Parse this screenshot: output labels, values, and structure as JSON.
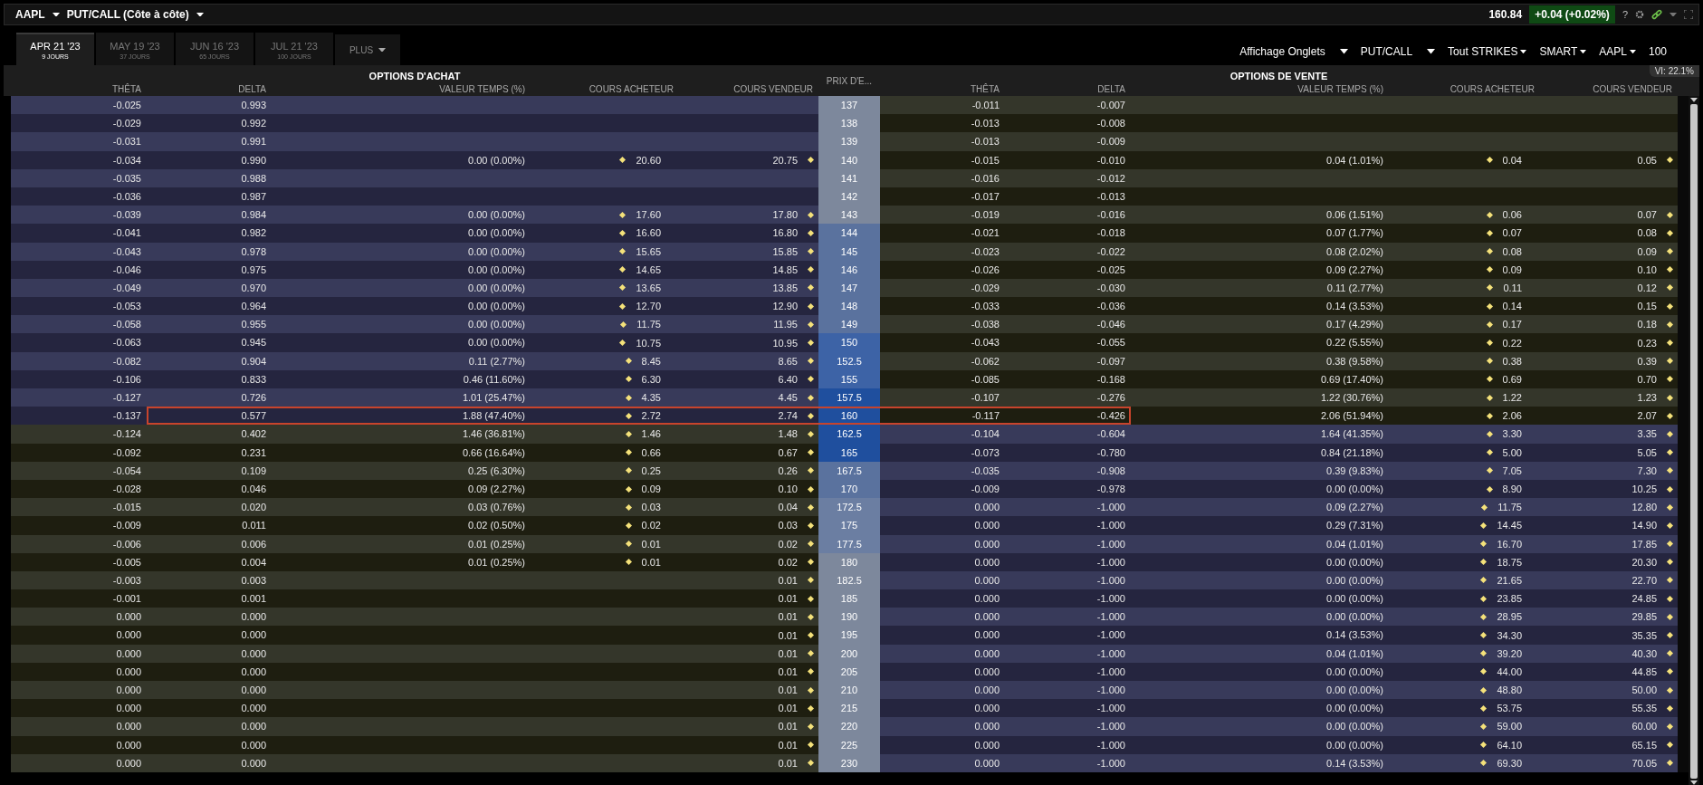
{
  "top_bar": {
    "symbol": "AAPL",
    "view": "PUT/CALL (Côte à côte)",
    "last_price": "160.84",
    "change": "+0.04 (+0.02%)",
    "help": "?"
  },
  "expiry_tabs": [
    {
      "label": "APR 21 '23",
      "days": "9 JOURS",
      "selected": true
    },
    {
      "label": "MAY 19 '23",
      "days": "37 JOURS",
      "selected": false
    },
    {
      "label": "JUN 16 '23",
      "days": "65 JOURS",
      "selected": false
    },
    {
      "label": "JUL 21 '23",
      "days": "100 JOURS",
      "selected": false
    }
  ],
  "more_tab": "PLUS",
  "toolbar": [
    {
      "label": "Affichage Onglets",
      "kind": "wide"
    },
    {
      "label": "PUT/CALL",
      "kind": "wide"
    },
    {
      "label": "Tout STRIKES",
      "kind": "compact"
    },
    {
      "label": "SMART",
      "kind": "compact"
    },
    {
      "label": "AAPL",
      "kind": "compact"
    },
    {
      "label": "100",
      "kind": "plain"
    }
  ],
  "implied_volatility": "VI: 22.1%",
  "calls_title": "OPTIONS D'ACHAT",
  "puts_title": "OPTIONS DE VENTE",
  "strike_header": "PRIX D'E...",
  "call_columns": [
    "THÊTA",
    "DELTA",
    "VALEUR TEMPS (%)",
    "COURS ACHETEUR",
    "COURS VENDEUR"
  ],
  "put_columns": [
    "THÊTA",
    "DELTA",
    "VALEUR TEMPS (%)",
    "COURS ACHETEUR",
    "COURS VENDEUR"
  ],
  "rows": [
    {
      "strike": "137",
      "color": "#7d889c",
      "calls_in_money": true,
      "puts_in_money": false,
      "selected": false,
      "call": {
        "theta": "-0.025",
        "delta": "0.993"
      },
      "put": {
        "theta": "-0.011",
        "delta": "-0.007"
      }
    },
    {
      "strike": "138",
      "color": "#7d889c",
      "calls_in_money": true,
      "puts_in_money": false,
      "selected": false,
      "call": {
        "theta": "-0.029",
        "delta": "0.992"
      },
      "put": {
        "theta": "-0.013",
        "delta": "-0.008"
      }
    },
    {
      "strike": "139",
      "color": "#7d889c",
      "calls_in_money": true,
      "puts_in_money": false,
      "selected": false,
      "call": {
        "theta": "-0.031",
        "delta": "0.991"
      },
      "put": {
        "theta": "-0.013",
        "delta": "-0.009"
      }
    },
    {
      "strike": "140",
      "color": "#7d889c",
      "calls_in_money": true,
      "puts_in_money": false,
      "selected": false,
      "call": {
        "theta": "-0.034",
        "delta": "0.990",
        "time_value": "0.00 (0.00%)",
        "bid": "20.60",
        "ask": "20.75"
      },
      "put": {
        "theta": "-0.015",
        "delta": "-0.010",
        "time_value": "0.04 (1.01%)",
        "bid": "0.04",
        "ask": "0.05"
      }
    },
    {
      "strike": "141",
      "color": "#7d889c",
      "calls_in_money": true,
      "puts_in_money": false,
      "selected": false,
      "call": {
        "theta": "-0.035",
        "delta": "0.988"
      },
      "put": {
        "theta": "-0.016",
        "delta": "-0.012"
      }
    },
    {
      "strike": "142",
      "color": "#7d889c",
      "calls_in_money": true,
      "puts_in_money": false,
      "selected": false,
      "call": {
        "theta": "-0.036",
        "delta": "0.987"
      },
      "put": {
        "theta": "-0.017",
        "delta": "-0.013"
      }
    },
    {
      "strike": "143",
      "color": "#7d889c",
      "calls_in_money": true,
      "puts_in_money": false,
      "selected": false,
      "call": {
        "theta": "-0.039",
        "delta": "0.984",
        "time_value": "0.00 (0.00%)",
        "bid": "17.60",
        "ask": "17.80"
      },
      "put": {
        "theta": "-0.019",
        "delta": "-0.016",
        "time_value": "0.06 (1.51%)",
        "bid": "0.06",
        "ask": "0.07"
      }
    },
    {
      "strike": "144",
      "color": "#5a729e",
      "calls_in_money": true,
      "puts_in_money": false,
      "selected": false,
      "call": {
        "theta": "-0.041",
        "delta": "0.982",
        "time_value": "0.00 (0.00%)",
        "bid": "16.60",
        "ask": "16.80"
      },
      "put": {
        "theta": "-0.021",
        "delta": "-0.018",
        "time_value": "0.07 (1.77%)",
        "bid": "0.07",
        "ask": "0.08"
      }
    },
    {
      "strike": "145",
      "color": "#5a729e",
      "calls_in_money": true,
      "puts_in_money": false,
      "selected": false,
      "call": {
        "theta": "-0.043",
        "delta": "0.978",
        "time_value": "0.00 (0.00%)",
        "bid": "15.65",
        "ask": "15.85"
      },
      "put": {
        "theta": "-0.023",
        "delta": "-0.022",
        "time_value": "0.08 (2.02%)",
        "bid": "0.08",
        "ask": "0.09"
      }
    },
    {
      "strike": "146",
      "color": "#5a729e",
      "calls_in_money": true,
      "puts_in_money": false,
      "selected": false,
      "call": {
        "theta": "-0.046",
        "delta": "0.975",
        "time_value": "0.00 (0.00%)",
        "bid": "14.65",
        "ask": "14.85"
      },
      "put": {
        "theta": "-0.026",
        "delta": "-0.025",
        "time_value": "0.09 (2.27%)",
        "bid": "0.09",
        "ask": "0.10"
      }
    },
    {
      "strike": "147",
      "color": "#5a729e",
      "calls_in_money": true,
      "puts_in_money": false,
      "selected": false,
      "call": {
        "theta": "-0.049",
        "delta": "0.970",
        "time_value": "0.00 (0.00%)",
        "bid": "13.65",
        "ask": "13.85"
      },
      "put": {
        "theta": "-0.029",
        "delta": "-0.030",
        "time_value": "0.11 (2.77%)",
        "bid": "0.11",
        "ask": "0.12"
      }
    },
    {
      "strike": "148",
      "color": "#5a729e",
      "calls_in_money": true,
      "puts_in_money": false,
      "selected": false,
      "call": {
        "theta": "-0.053",
        "delta": "0.964",
        "time_value": "0.00 (0.00%)",
        "bid": "12.70",
        "ask": "12.90"
      },
      "put": {
        "theta": "-0.033",
        "delta": "-0.036",
        "time_value": "0.14 (3.53%)",
        "bid": "0.14",
        "ask": "0.15"
      }
    },
    {
      "strike": "149",
      "color": "#5a729e",
      "calls_in_money": true,
      "puts_in_money": false,
      "selected": false,
      "call": {
        "theta": "-0.058",
        "delta": "0.955",
        "time_value": "0.00 (0.00%)",
        "bid": "11.75",
        "ask": "11.95"
      },
      "put": {
        "theta": "-0.038",
        "delta": "-0.046",
        "time_value": "0.17 (4.29%)",
        "bid": "0.17",
        "ask": "0.18"
      }
    },
    {
      "strike": "150",
      "color": "#3d63a6",
      "calls_in_money": true,
      "puts_in_money": false,
      "selected": false,
      "call": {
        "theta": "-0.063",
        "delta": "0.945",
        "time_value": "0.00 (0.00%)",
        "bid": "10.75",
        "ask": "10.95"
      },
      "put": {
        "theta": "-0.043",
        "delta": "-0.055",
        "time_value": "0.22 (5.55%)",
        "bid": "0.22",
        "ask": "0.23"
      }
    },
    {
      "strike": "152.5",
      "color": "#3d63a6",
      "calls_in_money": true,
      "puts_in_money": false,
      "selected": false,
      "call": {
        "theta": "-0.082",
        "delta": "0.904",
        "time_value": "0.11 (2.77%)",
        "bid": "8.45",
        "ask": "8.65"
      },
      "put": {
        "theta": "-0.062",
        "delta": "-0.097",
        "time_value": "0.38 (9.58%)",
        "bid": "0.38",
        "ask": "0.39"
      }
    },
    {
      "strike": "155",
      "color": "#3d63a6",
      "calls_in_money": true,
      "puts_in_money": false,
      "selected": false,
      "call": {
        "theta": "-0.106",
        "delta": "0.833",
        "time_value": "0.46 (11.60%)",
        "bid": "6.30",
        "ask": "6.40"
      },
      "put": {
        "theta": "-0.085",
        "delta": "-0.168",
        "time_value": "0.69 (17.40%)",
        "bid": "0.69",
        "ask": "0.70"
      }
    },
    {
      "strike": "157.5",
      "color": "#1f4f9e",
      "calls_in_money": true,
      "puts_in_money": false,
      "selected": false,
      "call": {
        "theta": "-0.127",
        "delta": "0.726",
        "time_value": "1.01 (25.47%)",
        "bid": "4.35",
        "ask": "4.45"
      },
      "put": {
        "theta": "-0.107",
        "delta": "-0.276",
        "time_value": "1.22 (30.76%)",
        "bid": "1.22",
        "ask": "1.23"
      }
    },
    {
      "strike": "160",
      "color": "#1f4f9e",
      "calls_in_money": true,
      "puts_in_money": false,
      "selected": true,
      "call": {
        "theta": "-0.137",
        "delta": "0.577",
        "time_value": "1.88 (47.40%)",
        "bid": "2.72",
        "ask": "2.74"
      },
      "put": {
        "theta": "-0.117",
        "delta": "-0.426",
        "time_value": "2.06 (51.94%)",
        "bid": "2.06",
        "ask": "2.07"
      }
    },
    {
      "strike": "162.5",
      "color": "#1f4f9e",
      "calls_in_money": false,
      "puts_in_money": true,
      "selected": false,
      "call": {
        "theta": "-0.124",
        "delta": "0.402",
        "time_value": "1.46 (36.81%)",
        "bid": "1.46",
        "ask": "1.48"
      },
      "put": {
        "theta": "-0.104",
        "delta": "-0.604",
        "time_value": "1.64 (41.35%)",
        "bid": "3.30",
        "ask": "3.35"
      }
    },
    {
      "strike": "165",
      "color": "#1f4f9e",
      "calls_in_money": false,
      "puts_in_money": true,
      "selected": false,
      "call": {
        "theta": "-0.092",
        "delta": "0.231",
        "time_value": "0.66 (16.64%)",
        "bid": "0.66",
        "ask": "0.67"
      },
      "put": {
        "theta": "-0.073",
        "delta": "-0.780",
        "time_value": "0.84 (21.18%)",
        "bid": "5.00",
        "ask": "5.05"
      }
    },
    {
      "strike": "167.5",
      "color": "#5a729e",
      "calls_in_money": false,
      "puts_in_money": true,
      "selected": false,
      "call": {
        "theta": "-0.054",
        "delta": "0.109",
        "time_value": "0.25 (6.30%)",
        "bid": "0.25",
        "ask": "0.26"
      },
      "put": {
        "theta": "-0.035",
        "delta": "-0.908",
        "time_value": "0.39 (9.83%)",
        "bid": "7.05",
        "ask": "7.30"
      }
    },
    {
      "strike": "170",
      "color": "#5a729e",
      "calls_in_money": false,
      "puts_in_money": true,
      "selected": false,
      "call": {
        "theta": "-0.028",
        "delta": "0.046",
        "time_value": "0.09 (2.27%)",
        "bid": "0.09",
        "ask": "0.10"
      },
      "put": {
        "theta": "-0.009",
        "delta": "-0.978",
        "time_value": "0.00 (0.00%)",
        "bid": "8.90",
        "ask": "10.25"
      }
    },
    {
      "strike": "172.5",
      "color": "#6b7ea2",
      "calls_in_money": false,
      "puts_in_money": true,
      "selected": false,
      "call": {
        "theta": "-0.015",
        "delta": "0.020",
        "time_value": "0.03 (0.76%)",
        "bid": "0.03",
        "ask": "0.04"
      },
      "put": {
        "theta": "0.000",
        "delta": "-1.000",
        "time_value": "0.09 (2.27%)",
        "bid": "11.75",
        "ask": "12.80"
      }
    },
    {
      "strike": "175",
      "color": "#6b7ea2",
      "calls_in_money": false,
      "puts_in_money": true,
      "selected": false,
      "call": {
        "theta": "-0.009",
        "delta": "0.011",
        "time_value": "0.02 (0.50%)",
        "bid": "0.02",
        "ask": "0.03"
      },
      "put": {
        "theta": "0.000",
        "delta": "-1.000",
        "time_value": "0.29 (7.31%)",
        "bid": "14.45",
        "ask": "14.90"
      }
    },
    {
      "strike": "177.5",
      "color": "#6b7ea2",
      "calls_in_money": false,
      "puts_in_money": true,
      "selected": false,
      "call": {
        "theta": "-0.006",
        "delta": "0.006",
        "time_value": "0.01 (0.25%)",
        "bid": "0.01",
        "ask": "0.02"
      },
      "put": {
        "theta": "0.000",
        "delta": "-1.000",
        "time_value": "0.04 (1.01%)",
        "bid": "16.70",
        "ask": "17.85"
      }
    },
    {
      "strike": "180",
      "color": "#7d889c",
      "calls_in_money": false,
      "puts_in_money": true,
      "selected": false,
      "call": {
        "theta": "-0.005",
        "delta": "0.004",
        "time_value": "0.01 (0.25%)",
        "bid": "0.01",
        "ask": "0.02"
      },
      "put": {
        "theta": "0.000",
        "delta": "-1.000",
        "time_value": "0.00 (0.00%)",
        "bid": "18.75",
        "ask": "20.30"
      }
    },
    {
      "strike": "182.5",
      "color": "#7d889c",
      "calls_in_money": false,
      "puts_in_money": true,
      "selected": false,
      "call": {
        "theta": "-0.003",
        "delta": "0.003",
        "ask": "0.01"
      },
      "put": {
        "theta": "0.000",
        "delta": "-1.000",
        "time_value": "0.00 (0.00%)",
        "bid": "21.65",
        "ask": "22.70"
      }
    },
    {
      "strike": "185",
      "color": "#7d889c",
      "calls_in_money": false,
      "puts_in_money": true,
      "selected": false,
      "call": {
        "theta": "-0.001",
        "delta": "0.001",
        "ask": "0.01"
      },
      "put": {
        "theta": "0.000",
        "delta": "-1.000",
        "time_value": "0.00 (0.00%)",
        "bid": "23.85",
        "ask": "24.85"
      }
    },
    {
      "strike": "190",
      "color": "#7d889c",
      "calls_in_money": false,
      "puts_in_money": true,
      "selected": false,
      "call": {
        "theta": "0.000",
        "delta": "0.000",
        "ask": "0.01"
      },
      "put": {
        "theta": "0.000",
        "delta": "-1.000",
        "time_value": "0.00 (0.00%)",
        "bid": "28.95",
        "ask": "29.85"
      }
    },
    {
      "strike": "195",
      "color": "#7d889c",
      "calls_in_money": false,
      "puts_in_money": true,
      "selected": false,
      "call": {
        "theta": "0.000",
        "delta": "0.000",
        "ask": "0.01"
      },
      "put": {
        "theta": "0.000",
        "delta": "-1.000",
        "time_value": "0.14 (3.53%)",
        "bid": "34.30",
        "ask": "35.35"
      }
    },
    {
      "strike": "200",
      "color": "#7d889c",
      "calls_in_money": false,
      "puts_in_money": true,
      "selected": false,
      "call": {
        "theta": "0.000",
        "delta": "0.000",
        "ask": "0.01"
      },
      "put": {
        "theta": "0.000",
        "delta": "-1.000",
        "time_value": "0.04 (1.01%)",
        "bid": "39.20",
        "ask": "40.30"
      }
    },
    {
      "strike": "205",
      "color": "#7d889c",
      "calls_in_money": false,
      "puts_in_money": true,
      "selected": false,
      "call": {
        "theta": "0.000",
        "delta": "0.000",
        "ask": "0.01"
      },
      "put": {
        "theta": "0.000",
        "delta": "-1.000",
        "time_value": "0.00 (0.00%)",
        "bid": "44.00",
        "ask": "44.85"
      }
    },
    {
      "strike": "210",
      "color": "#7d889c",
      "calls_in_money": false,
      "puts_in_money": true,
      "selected": false,
      "call": {
        "theta": "0.000",
        "delta": "0.000",
        "ask": "0.01"
      },
      "put": {
        "theta": "0.000",
        "delta": "-1.000",
        "time_value": "0.00 (0.00%)",
        "bid": "48.80",
        "ask": "50.00"
      }
    },
    {
      "strike": "215",
      "color": "#7d889c",
      "calls_in_money": false,
      "puts_in_money": true,
      "selected": false,
      "call": {
        "theta": "0.000",
        "delta": "0.000",
        "ask": "0.01"
      },
      "put": {
        "theta": "0.000",
        "delta": "-1.000",
        "time_value": "0.00 (0.00%)",
        "bid": "53.75",
        "ask": "55.35"
      }
    },
    {
      "strike": "220",
      "color": "#7d889c",
      "calls_in_money": false,
      "puts_in_money": true,
      "selected": false,
      "call": {
        "theta": "0.000",
        "delta": "0.000",
        "ask": "0.01"
      },
      "put": {
        "theta": "0.000",
        "delta": "-1.000",
        "time_value": "0.00 (0.00%)",
        "bid": "59.00",
        "ask": "60.00"
      }
    },
    {
      "strike": "225",
      "color": "#7d889c",
      "calls_in_money": false,
      "puts_in_money": true,
      "selected": false,
      "call": {
        "theta": "0.000",
        "delta": "0.000",
        "ask": "0.01"
      },
      "put": {
        "theta": "0.000",
        "delta": "-1.000",
        "time_value": "0.00 (0.00%)",
        "bid": "64.10",
        "ask": "65.15"
      }
    },
    {
      "strike": "230",
      "color": "#7d889c",
      "calls_in_money": false,
      "puts_in_money": true,
      "selected": false,
      "call": {
        "theta": "0.000",
        "delta": "0.000",
        "ask": "0.01"
      },
      "put": {
        "theta": "0.000",
        "delta": "-1.000",
        "time_value": "0.14 (3.53%)",
        "bid": "69.30",
        "ask": "70.05"
      }
    }
  ]
}
